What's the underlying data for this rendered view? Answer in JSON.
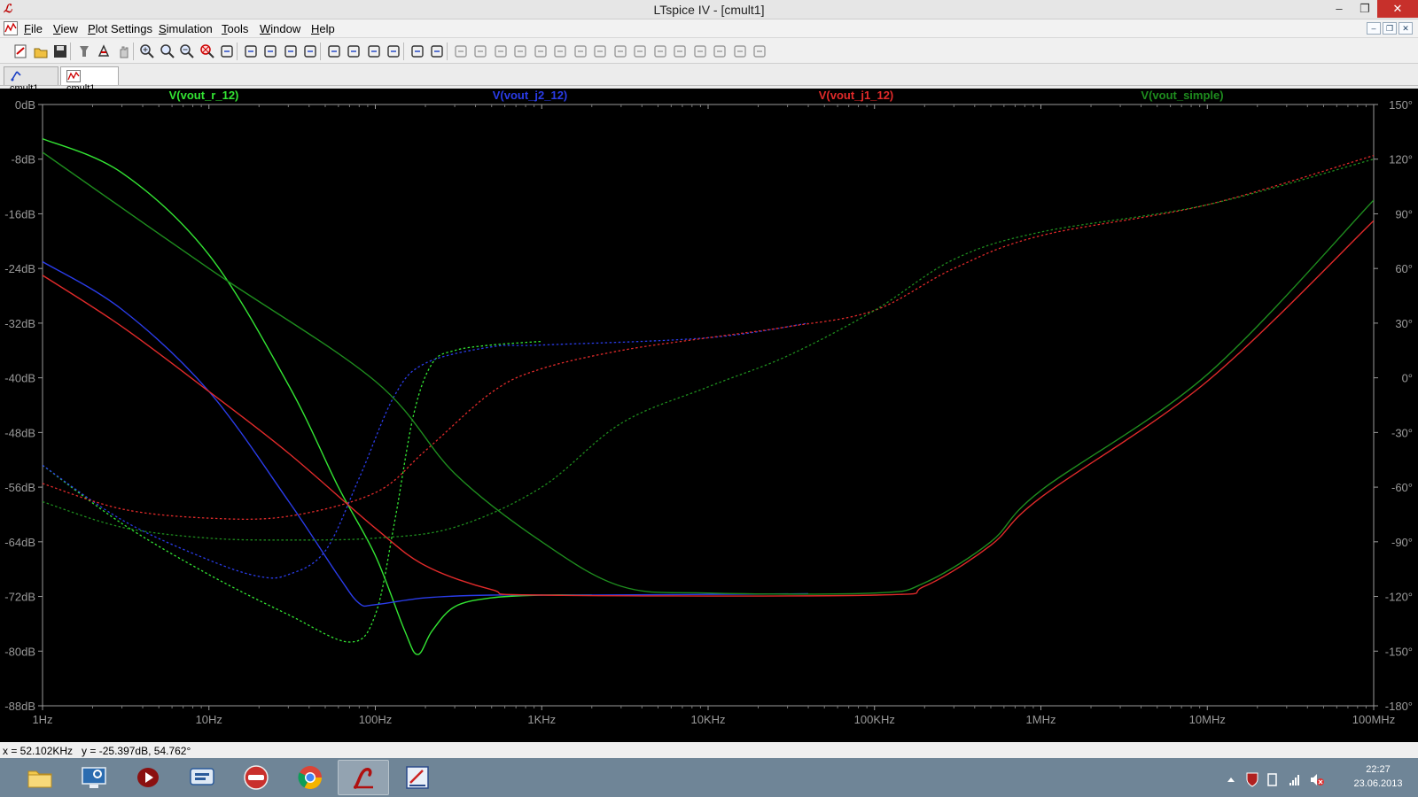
{
  "window": {
    "title": "LTspice IV - [cmult1]",
    "app_icon": "ltspice-logo-icon",
    "controls": {
      "minimize": "–",
      "maximize": "❐",
      "close": "✕"
    }
  },
  "menu": {
    "items": [
      {
        "id": "file",
        "label": "File"
      },
      {
        "id": "view",
        "label": "View"
      },
      {
        "id": "plot-settings",
        "label": "Plot Settings"
      },
      {
        "id": "simulation",
        "label": "Simulation"
      },
      {
        "id": "tools",
        "label": "Tools"
      },
      {
        "id": "window",
        "label": "Window"
      },
      {
        "id": "help",
        "label": "Help"
      }
    ],
    "mdi_controls": {
      "minimize": "–",
      "restore": "❐",
      "close": "✕"
    }
  },
  "toolbar": {
    "buttons": [
      "new-schematic-icon",
      "open-icon",
      "save-icon",
      "control-panel-icon",
      "run-icon",
      "halt-icon",
      "zoom-in-icon",
      "zoom-pan-icon",
      "zoom-out-icon",
      "zoom-fit-icon",
      "autorange-icon",
      "tile-icon",
      "stack-icon",
      "cascade-icon",
      "arrange-icon",
      "cut-icon",
      "copy-icon",
      "paste-icon",
      "find-icon",
      "print-preview-icon",
      "print-icon",
      "wire-icon",
      "ground-icon",
      "label-icon",
      "resistor-icon",
      "capacitor-icon",
      "inductor-icon",
      "diode-icon",
      "component-icon",
      "move-icon",
      "drag-icon",
      "undo-icon",
      "redo-icon",
      "rotate-icon",
      "mirror-icon",
      "text-icon",
      "spice-directive-icon"
    ]
  },
  "tabs": [
    {
      "label": "cmult1",
      "icon": "schematic-icon",
      "active": false
    },
    {
      "label": "cmult1",
      "icon": "waveform-icon",
      "active": true
    }
  ],
  "chart_data": {
    "type": "line",
    "xscale": "log",
    "xlim": [
      1,
      100000000
    ],
    "x_tick_labels": [
      "1Hz",
      "10Hz",
      "100Hz",
      "1KHz",
      "10KHz",
      "100KHz",
      "1MHz",
      "10MHz",
      "100MHz"
    ],
    "x_tick_values": [
      1,
      10,
      100,
      1000,
      10000,
      100000,
      1000000,
      10000000,
      100000000
    ],
    "ylim_left": [
      -88,
      0
    ],
    "y_left_tick_labels": [
      "0dB",
      "-8dB",
      "-16dB",
      "-24dB",
      "-32dB",
      "-40dB",
      "-48dB",
      "-56dB",
      "-64dB",
      "-72dB",
      "-80dB",
      "-88dB"
    ],
    "y_left_tick_values": [
      0,
      -8,
      -16,
      -24,
      -32,
      -40,
      -48,
      -56,
      -64,
      -72,
      -80,
      -88
    ],
    "ylim_right": [
      -180,
      150
    ],
    "y_right_tick_labels": [
      "150°",
      "120°",
      "90°",
      "60°",
      "30°",
      "0°",
      "-30°",
      "-60°",
      "-90°",
      "-120°",
      "-150°",
      "-180°"
    ],
    "y_right_tick_values": [
      150,
      120,
      90,
      60,
      30,
      0,
      -30,
      -60,
      -90,
      -120,
      -150,
      -180
    ],
    "grid": false,
    "legend_position": "top",
    "series": [
      {
        "name": "V(vout_r_12)",
        "color": "#33e433",
        "magnitude_db": [
          [
            1,
            -5
          ],
          [
            3,
            -10
          ],
          [
            10,
            -22
          ],
          [
            30,
            -41
          ],
          [
            60,
            -56
          ],
          [
            100,
            -66
          ],
          [
            150,
            -77
          ],
          [
            180,
            -80.5
          ],
          [
            220,
            -77
          ],
          [
            300,
            -73.5
          ],
          [
            500,
            -72.2
          ],
          [
            1000,
            -71.8
          ],
          [
            2000,
            -71.8
          ]
        ],
        "phase_deg": [
          [
            1,
            -48
          ],
          [
            3,
            -80
          ],
          [
            10,
            -108
          ],
          [
            30,
            -130
          ],
          [
            70,
            -145
          ],
          [
            100,
            -130
          ],
          [
            130,
            -80
          ],
          [
            170,
            -20
          ],
          [
            220,
            8
          ],
          [
            300,
            15
          ],
          [
            500,
            18
          ],
          [
            1000,
            20
          ]
        ]
      },
      {
        "name": "V(vout_j2_12)",
        "color": "#2a3ce8",
        "magnitude_db": [
          [
            1,
            -23
          ],
          [
            3,
            -30
          ],
          [
            10,
            -42
          ],
          [
            30,
            -58
          ],
          [
            60,
            -69
          ],
          [
            80,
            -73
          ],
          [
            100,
            -73.2
          ],
          [
            200,
            -72.2
          ],
          [
            500,
            -71.8
          ],
          [
            2000,
            -71.8
          ],
          [
            40000,
            -71.6
          ]
        ],
        "phase_deg": [
          [
            1,
            -48
          ],
          [
            3,
            -78
          ],
          [
            10,
            -100
          ],
          [
            20,
            -109
          ],
          [
            30,
            -108
          ],
          [
            50,
            -95
          ],
          [
            80,
            -55
          ],
          [
            130,
            -10
          ],
          [
            200,
            8
          ],
          [
            500,
            17
          ],
          [
            1000,
            18
          ],
          [
            10000,
            22
          ],
          [
            40000,
            30
          ]
        ]
      },
      {
        "name": "V(vout_j1_12)",
        "color": "#e02a2a",
        "magnitude_db": [
          [
            1,
            -25
          ],
          [
            3,
            -32.5
          ],
          [
            10,
            -42
          ],
          [
            30,
            -51
          ],
          [
            100,
            -62
          ],
          [
            200,
            -67.5
          ],
          [
            500,
            -71
          ],
          [
            1000,
            -71.8
          ],
          [
            100000,
            -71.8
          ],
          [
            200000,
            -70.5
          ],
          [
            500000,
            -64.5
          ],
          [
            1000000,
            -57.5
          ],
          [
            10000000,
            -40.5
          ],
          [
            100000000,
            -17
          ]
        ],
        "phase_deg": [
          [
            1,
            -58
          ],
          [
            3,
            -72
          ],
          [
            10,
            -77
          ],
          [
            30,
            -76
          ],
          [
            100,
            -63
          ],
          [
            200,
            -40
          ],
          [
            500,
            -8
          ],
          [
            1000,
            5
          ],
          [
            3000,
            15
          ],
          [
            10000,
            22
          ],
          [
            30000,
            28
          ],
          [
            100000,
            37
          ],
          [
            300000,
            60
          ],
          [
            1000000,
            78
          ],
          [
            10000000,
            95
          ],
          [
            100000000,
            122
          ]
        ]
      },
      {
        "name": "V(vout_simple)",
        "color": "#1e8c1e",
        "magnitude_db": [
          [
            1,
            -7
          ],
          [
            10,
            -24
          ],
          [
            100,
            -40.5
          ],
          [
            300,
            -54
          ],
          [
            1000,
            -64
          ],
          [
            3000,
            -70.5
          ],
          [
            10000,
            -71.5
          ],
          [
            100000,
            -71.5
          ],
          [
            200000,
            -70
          ],
          [
            500000,
            -64
          ],
          [
            1000000,
            -56.5
          ],
          [
            10000000,
            -39.5
          ],
          [
            100000000,
            -14
          ]
        ],
        "phase_deg": [
          [
            1,
            -68
          ],
          [
            3,
            -82
          ],
          [
            10,
            -88
          ],
          [
            30,
            -89
          ],
          [
            100,
            -88
          ],
          [
            300,
            -82
          ],
          [
            1000,
            -60
          ],
          [
            3000,
            -25
          ],
          [
            10000,
            -5
          ],
          [
            30000,
            12
          ],
          [
            100000,
            37
          ],
          [
            300000,
            65
          ],
          [
            1000000,
            80
          ],
          [
            10000000,
            95
          ],
          [
            100000000,
            120
          ]
        ]
      }
    ]
  },
  "status": {
    "readout": "x = 52.102KHz   y = -25.397dB, 54.762°"
  },
  "taskbar": {
    "apps": [
      {
        "id": "file-explorer",
        "icon": "folder-icon",
        "active": false
      },
      {
        "id": "remote-desktop",
        "icon": "remote-desktop-icon",
        "active": false
      },
      {
        "id": "media-player",
        "icon": "media-player-icon",
        "active": false
      },
      {
        "id": "messenger",
        "icon": "chat-icon",
        "active": false
      },
      {
        "id": "nero",
        "icon": "nero-icon",
        "active": false
      },
      {
        "id": "chrome",
        "icon": "chrome-icon",
        "active": false
      },
      {
        "id": "ltspice",
        "icon": "ltspice-icon",
        "active": true
      },
      {
        "id": "editor",
        "icon": "editor-icon",
        "active": false
      }
    ],
    "clock": {
      "time": "22:27",
      "date": "23.06.2013"
    }
  }
}
